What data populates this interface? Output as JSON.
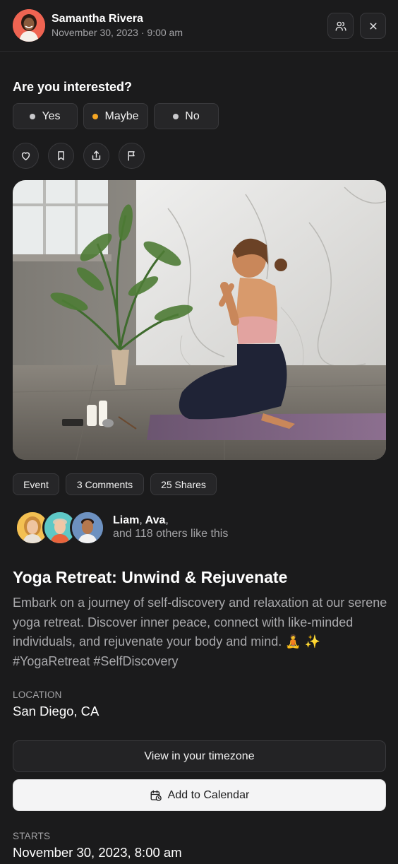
{
  "header": {
    "user_name": "Samantha Rivera",
    "post_date": "November 30, 2023 · 9:00 am",
    "icons": [
      "users-icon",
      "close-icon"
    ]
  },
  "rsvp": {
    "question": "Are you interested?",
    "options": [
      {
        "label": "Yes",
        "dot_color": "#c9c9cc"
      },
      {
        "label": "Maybe",
        "dot_color": "#f5a623"
      },
      {
        "label": "No",
        "dot_color": "#c9c9cc"
      }
    ]
  },
  "actions": [
    "heart-icon",
    "bookmark-icon",
    "share-icon",
    "flag-icon"
  ],
  "chips": {
    "type": "Event",
    "comments": "3 Comments",
    "shares": "25 Shares"
  },
  "likes": {
    "name1": "Liam",
    "name2": "Ava",
    "separator": ",",
    "rest": "and 118 others like this"
  },
  "event": {
    "title": "Yoga Retreat: Unwind & Rejuvenate",
    "description": "Embark on a journey of self-discovery and relaxation at our serene yoga retreat. Discover inner peace, connect with like-minded individuals, and rejuvenate your body and mind. 🧘 ✨ #YogaRetreat #SelfDiscovery",
    "location_label": "Location",
    "location": "San Diego, CA",
    "timezone_button": "View in your timezone",
    "calendar_button": "Add to Calendar",
    "starts_label": "Starts",
    "starts": "November 30, 2023, 8:00 am"
  },
  "colors": {
    "background": "#1b1b1c",
    "surface": "#262628",
    "border": "#39393c",
    "accent_maybe": "#f5a623",
    "muted_text": "#a3a3a6"
  }
}
